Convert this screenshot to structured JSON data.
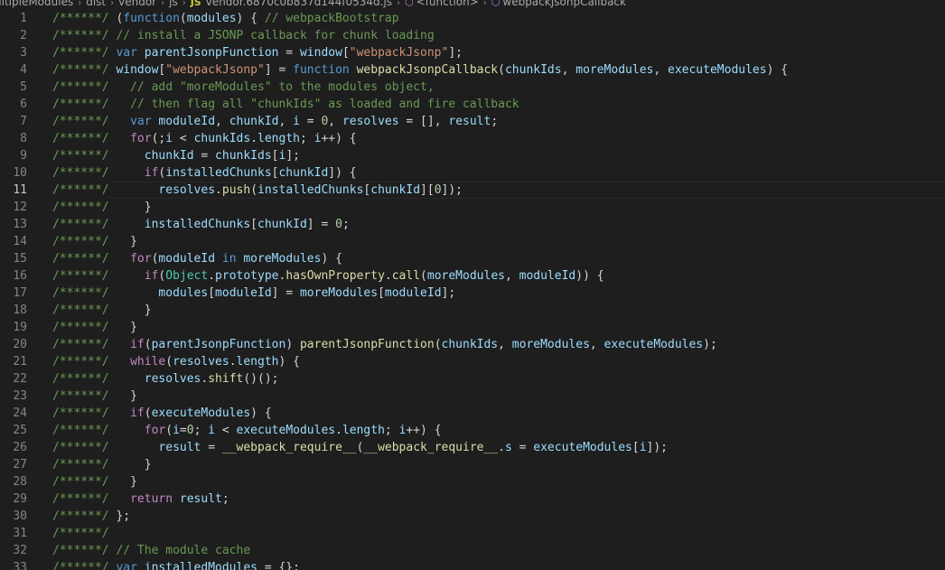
{
  "breadcrumb": {
    "items": [
      {
        "label": "ultipleModules",
        "icon": null
      },
      {
        "label": "dist",
        "icon": null
      },
      {
        "label": "vendor",
        "icon": null
      },
      {
        "label": "js",
        "icon": null
      },
      {
        "label": "vendor.6870c0b837d144f0534d.js",
        "icon": "JS"
      },
      {
        "label": "<function>",
        "icon": "cube"
      },
      {
        "label": "webpackJsonpCallback",
        "icon": "cube"
      }
    ],
    "separator": "›"
  },
  "editor": {
    "current_line": 11,
    "lines": [
      {
        "n": "1",
        "tokens": [
          [
            "comment",
            "/******/"
          ],
          [
            "plain",
            " ("
          ],
          [
            "keyword",
            "function"
          ],
          [
            "plain",
            "("
          ],
          [
            "variable",
            "modules"
          ],
          [
            "plain",
            ") { "
          ],
          [
            "comment",
            "// webpackBootstrap"
          ]
        ]
      },
      {
        "n": "2",
        "tokens": [
          [
            "comment",
            "/******/"
          ],
          [
            "plain",
            " "
          ],
          [
            "comment",
            "// install a JSONP callback for chunk loading"
          ]
        ]
      },
      {
        "n": "3",
        "tokens": [
          [
            "comment",
            "/******/"
          ],
          [
            "plain",
            " "
          ],
          [
            "keyword",
            "var"
          ],
          [
            "plain",
            " "
          ],
          [
            "variable",
            "parentJsonpFunction"
          ],
          [
            "plain",
            " = "
          ],
          [
            "variable",
            "window"
          ],
          [
            "plain",
            "["
          ],
          [
            "string",
            "\"webpackJsonp\""
          ],
          [
            "plain",
            "];"
          ]
        ]
      },
      {
        "n": "4",
        "tokens": [
          [
            "comment",
            "/******/"
          ],
          [
            "plain",
            " "
          ],
          [
            "variable",
            "window"
          ],
          [
            "plain",
            "["
          ],
          [
            "string",
            "\"webpackJsonp\""
          ],
          [
            "plain",
            "] = "
          ],
          [
            "keyword",
            "function"
          ],
          [
            "plain",
            " "
          ],
          [
            "function",
            "webpackJsonpCallback"
          ],
          [
            "plain",
            "("
          ],
          [
            "variable",
            "chunkIds"
          ],
          [
            "plain",
            ", "
          ],
          [
            "variable",
            "moreModules"
          ],
          [
            "plain",
            ", "
          ],
          [
            "variable",
            "executeModules"
          ],
          [
            "plain",
            ") {"
          ]
        ]
      },
      {
        "n": "5",
        "tokens": [
          [
            "comment",
            "/******/"
          ],
          [
            "plain",
            "   "
          ],
          [
            "comment",
            "// add \"moreModules\" to the modules object,"
          ]
        ]
      },
      {
        "n": "6",
        "tokens": [
          [
            "comment",
            "/******/"
          ],
          [
            "plain",
            "   "
          ],
          [
            "comment",
            "// then flag all \"chunkIds\" as loaded and fire callback"
          ]
        ]
      },
      {
        "n": "7",
        "tokens": [
          [
            "comment",
            "/******/"
          ],
          [
            "plain",
            "   "
          ],
          [
            "keyword",
            "var"
          ],
          [
            "plain",
            " "
          ],
          [
            "variable",
            "moduleId"
          ],
          [
            "plain",
            ", "
          ],
          [
            "variable",
            "chunkId"
          ],
          [
            "plain",
            ", "
          ],
          [
            "variable",
            "i"
          ],
          [
            "plain",
            " = "
          ],
          [
            "number",
            "0"
          ],
          [
            "plain",
            ", "
          ],
          [
            "variable",
            "resolves"
          ],
          [
            "plain",
            " = [], "
          ],
          [
            "variable",
            "result"
          ],
          [
            "plain",
            ";"
          ]
        ]
      },
      {
        "n": "8",
        "tokens": [
          [
            "comment",
            "/******/"
          ],
          [
            "plain",
            "   "
          ],
          [
            "control",
            "for"
          ],
          [
            "plain",
            "(;"
          ],
          [
            "variable",
            "i"
          ],
          [
            "plain",
            " < "
          ],
          [
            "variable",
            "chunkIds"
          ],
          [
            "plain",
            "."
          ],
          [
            "variable",
            "length"
          ],
          [
            "plain",
            "; "
          ],
          [
            "variable",
            "i"
          ],
          [
            "plain",
            "++) {"
          ]
        ]
      },
      {
        "n": "9",
        "tokens": [
          [
            "comment",
            "/******/"
          ],
          [
            "plain",
            "     "
          ],
          [
            "variable",
            "chunkId"
          ],
          [
            "plain",
            " = "
          ],
          [
            "variable",
            "chunkIds"
          ],
          [
            "plain",
            "["
          ],
          [
            "variable",
            "i"
          ],
          [
            "plain",
            "];"
          ]
        ]
      },
      {
        "n": "10",
        "tokens": [
          [
            "comment",
            "/******/"
          ],
          [
            "plain",
            "     "
          ],
          [
            "control",
            "if"
          ],
          [
            "plain",
            "("
          ],
          [
            "variable",
            "installedChunks"
          ],
          [
            "plain",
            "["
          ],
          [
            "variable",
            "chunkId"
          ],
          [
            "plain",
            "]) {"
          ]
        ]
      },
      {
        "n": "11",
        "tokens": [
          [
            "comment",
            "/******/"
          ],
          [
            "plain",
            "       "
          ],
          [
            "variable",
            "resolves"
          ],
          [
            "plain",
            "."
          ],
          [
            "function",
            "push"
          ],
          [
            "plain",
            "("
          ],
          [
            "variable",
            "installedChunks"
          ],
          [
            "plain",
            "["
          ],
          [
            "variable",
            "chunkId"
          ],
          [
            "plain",
            "]["
          ],
          [
            "number",
            "0"
          ],
          [
            "plain",
            "]);"
          ]
        ]
      },
      {
        "n": "12",
        "tokens": [
          [
            "comment",
            "/******/"
          ],
          [
            "plain",
            "     }"
          ]
        ]
      },
      {
        "n": "13",
        "tokens": [
          [
            "comment",
            "/******/"
          ],
          [
            "plain",
            "     "
          ],
          [
            "variable",
            "installedChunks"
          ],
          [
            "plain",
            "["
          ],
          [
            "variable",
            "chunkId"
          ],
          [
            "plain",
            "] = "
          ],
          [
            "number",
            "0"
          ],
          [
            "plain",
            ";"
          ]
        ]
      },
      {
        "n": "14",
        "tokens": [
          [
            "comment",
            "/******/"
          ],
          [
            "plain",
            "   }"
          ]
        ]
      },
      {
        "n": "15",
        "tokens": [
          [
            "comment",
            "/******/"
          ],
          [
            "plain",
            "   "
          ],
          [
            "control",
            "for"
          ],
          [
            "plain",
            "("
          ],
          [
            "variable",
            "moduleId"
          ],
          [
            "plain",
            " "
          ],
          [
            "keyword",
            "in"
          ],
          [
            "plain",
            " "
          ],
          [
            "variable",
            "moreModules"
          ],
          [
            "plain",
            ") {"
          ]
        ]
      },
      {
        "n": "16",
        "tokens": [
          [
            "comment",
            "/******/"
          ],
          [
            "plain",
            "     "
          ],
          [
            "control",
            "if"
          ],
          [
            "plain",
            "("
          ],
          [
            "type",
            "Object"
          ],
          [
            "plain",
            "."
          ],
          [
            "variable",
            "prototype"
          ],
          [
            "plain",
            "."
          ],
          [
            "function",
            "hasOwnProperty"
          ],
          [
            "plain",
            "."
          ],
          [
            "function",
            "call"
          ],
          [
            "plain",
            "("
          ],
          [
            "variable",
            "moreModules"
          ],
          [
            "plain",
            ", "
          ],
          [
            "variable",
            "moduleId"
          ],
          [
            "plain",
            ")) {"
          ]
        ]
      },
      {
        "n": "17",
        "tokens": [
          [
            "comment",
            "/******/"
          ],
          [
            "plain",
            "       "
          ],
          [
            "variable",
            "modules"
          ],
          [
            "plain",
            "["
          ],
          [
            "variable",
            "moduleId"
          ],
          [
            "plain",
            "] = "
          ],
          [
            "variable",
            "moreModules"
          ],
          [
            "plain",
            "["
          ],
          [
            "variable",
            "moduleId"
          ],
          [
            "plain",
            "];"
          ]
        ]
      },
      {
        "n": "18",
        "tokens": [
          [
            "comment",
            "/******/"
          ],
          [
            "plain",
            "     }"
          ]
        ]
      },
      {
        "n": "19",
        "tokens": [
          [
            "comment",
            "/******/"
          ],
          [
            "plain",
            "   }"
          ]
        ]
      },
      {
        "n": "20",
        "tokens": [
          [
            "comment",
            "/******/"
          ],
          [
            "plain",
            "   "
          ],
          [
            "control",
            "if"
          ],
          [
            "plain",
            "("
          ],
          [
            "variable",
            "parentJsonpFunction"
          ],
          [
            "plain",
            ") "
          ],
          [
            "function",
            "parentJsonpFunction"
          ],
          [
            "plain",
            "("
          ],
          [
            "variable",
            "chunkIds"
          ],
          [
            "plain",
            ", "
          ],
          [
            "variable",
            "moreModules"
          ],
          [
            "plain",
            ", "
          ],
          [
            "variable",
            "executeModules"
          ],
          [
            "plain",
            ");"
          ]
        ]
      },
      {
        "n": "21",
        "tokens": [
          [
            "comment",
            "/******/"
          ],
          [
            "plain",
            "   "
          ],
          [
            "control",
            "while"
          ],
          [
            "plain",
            "("
          ],
          [
            "variable",
            "resolves"
          ],
          [
            "plain",
            "."
          ],
          [
            "variable",
            "length"
          ],
          [
            "plain",
            ") {"
          ]
        ]
      },
      {
        "n": "22",
        "tokens": [
          [
            "comment",
            "/******/"
          ],
          [
            "plain",
            "     "
          ],
          [
            "variable",
            "resolves"
          ],
          [
            "plain",
            "."
          ],
          [
            "function",
            "shift"
          ],
          [
            "plain",
            "()();"
          ]
        ]
      },
      {
        "n": "23",
        "tokens": [
          [
            "comment",
            "/******/"
          ],
          [
            "plain",
            "   }"
          ]
        ]
      },
      {
        "n": "24",
        "tokens": [
          [
            "comment",
            "/******/"
          ],
          [
            "plain",
            "   "
          ],
          [
            "control",
            "if"
          ],
          [
            "plain",
            "("
          ],
          [
            "variable",
            "executeModules"
          ],
          [
            "plain",
            ") {"
          ]
        ]
      },
      {
        "n": "25",
        "tokens": [
          [
            "comment",
            "/******/"
          ],
          [
            "plain",
            "     "
          ],
          [
            "control",
            "for"
          ],
          [
            "plain",
            "("
          ],
          [
            "variable",
            "i"
          ],
          [
            "plain",
            "="
          ],
          [
            "number",
            "0"
          ],
          [
            "plain",
            "; "
          ],
          [
            "variable",
            "i"
          ],
          [
            "plain",
            " < "
          ],
          [
            "variable",
            "executeModules"
          ],
          [
            "plain",
            "."
          ],
          [
            "variable",
            "length"
          ],
          [
            "plain",
            "; "
          ],
          [
            "variable",
            "i"
          ],
          [
            "plain",
            "++) {"
          ]
        ]
      },
      {
        "n": "26",
        "tokens": [
          [
            "comment",
            "/******/"
          ],
          [
            "plain",
            "       "
          ],
          [
            "variable",
            "result"
          ],
          [
            "plain",
            " = "
          ],
          [
            "function",
            "__webpack_require__"
          ],
          [
            "plain",
            "("
          ],
          [
            "function",
            "__webpack_require__"
          ],
          [
            "plain",
            "."
          ],
          [
            "variable",
            "s"
          ],
          [
            "plain",
            " = "
          ],
          [
            "variable",
            "executeModules"
          ],
          [
            "plain",
            "["
          ],
          [
            "variable",
            "i"
          ],
          [
            "plain",
            "]);"
          ]
        ]
      },
      {
        "n": "27",
        "tokens": [
          [
            "comment",
            "/******/"
          ],
          [
            "plain",
            "     }"
          ]
        ]
      },
      {
        "n": "28",
        "tokens": [
          [
            "comment",
            "/******/"
          ],
          [
            "plain",
            "   }"
          ]
        ]
      },
      {
        "n": "29",
        "tokens": [
          [
            "comment",
            "/******/"
          ],
          [
            "plain",
            "   "
          ],
          [
            "control",
            "return"
          ],
          [
            "plain",
            " "
          ],
          [
            "variable",
            "result"
          ],
          [
            "plain",
            ";"
          ]
        ]
      },
      {
        "n": "30",
        "tokens": [
          [
            "comment",
            "/******/"
          ],
          [
            "plain",
            " };"
          ]
        ]
      },
      {
        "n": "31",
        "tokens": [
          [
            "comment",
            "/******/"
          ]
        ]
      },
      {
        "n": "32",
        "tokens": [
          [
            "comment",
            "/******/"
          ],
          [
            "plain",
            " "
          ],
          [
            "comment",
            "// The module cache"
          ]
        ]
      },
      {
        "n": "33",
        "tokens": [
          [
            "comment",
            "/******/"
          ],
          [
            "plain",
            " "
          ],
          [
            "keyword",
            "var"
          ],
          [
            "plain",
            " "
          ],
          [
            "variable",
            "installedModules"
          ],
          [
            "plain",
            " = {};"
          ]
        ]
      }
    ]
  }
}
